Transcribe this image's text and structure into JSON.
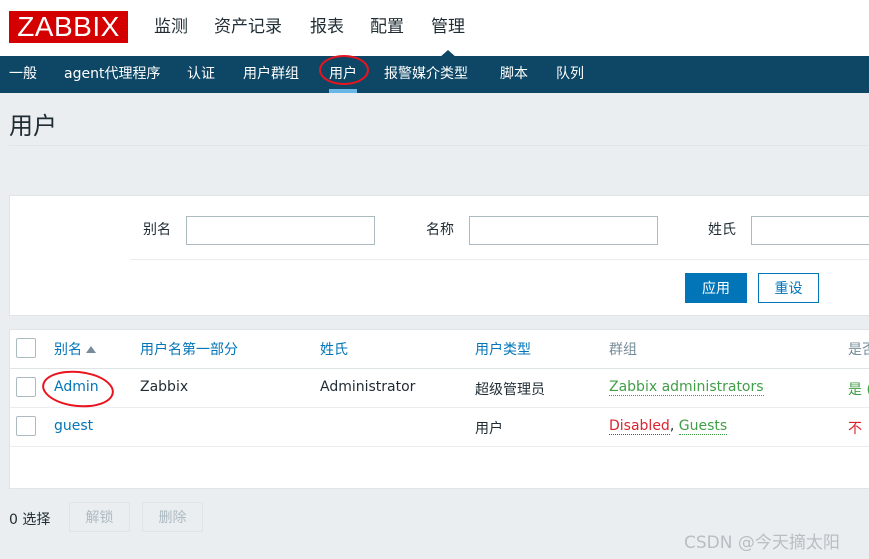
{
  "logo": {
    "text": "ZABBIX"
  },
  "main_nav": [
    "监测",
    "资产记录",
    "报表",
    "配置",
    "管理"
  ],
  "sub_nav": [
    "一般",
    "agent代理程序",
    "认证",
    "用户群组",
    "用户",
    "报警媒介类型",
    "脚本",
    "队列"
  ],
  "page": {
    "title": "用户"
  },
  "filter": {
    "alias_label": "别名",
    "alias_value": "",
    "name_label": "名称",
    "name_value": "",
    "surname_label": "姓氏",
    "surname_value": "",
    "apply_label": "应用",
    "reset_label": "重设"
  },
  "table": {
    "headers": [
      "别名",
      "用户名第一部分",
      "姓氏",
      "用户类型",
      "群组",
      "是否"
    ],
    "rows": [
      {
        "alias": "Admin",
        "name": "Zabbix",
        "surname": "Administrator",
        "type": "超级管理员",
        "groups": [
          {
            "text": "Zabbix administrators",
            "sep": ""
          }
        ],
        "status": "是 ("
      },
      {
        "alias": "guest",
        "name": "",
        "surname": "",
        "type": "用户",
        "groups": [
          {
            "text": "Disabled",
            "sep": ", "
          },
          {
            "text": "Guests",
            "sep": ""
          }
        ],
        "status": "不"
      }
    ]
  },
  "footer": {
    "selected": "0 选择",
    "unlock_label": "解锁",
    "delete_label": "删除"
  },
  "watermark": "CSDN @今天摘太阳",
  "colors": {
    "logo": "#d40000",
    "subnav": "#0e4765",
    "link": "#0275b8",
    "green": "#429e47",
    "red": "#dc2430"
  }
}
